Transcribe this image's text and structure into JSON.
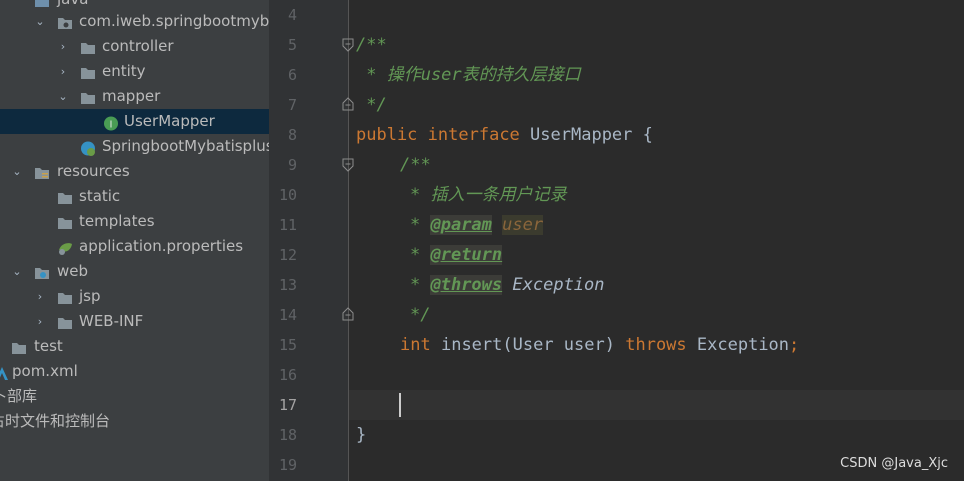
{
  "tree": {
    "items": [
      {
        "label": "java"
      },
      {
        "label": "com.iweb.springbootmyba"
      },
      {
        "label": "controller"
      },
      {
        "label": "entity"
      },
      {
        "label": "mapper"
      },
      {
        "label": "UserMapper"
      },
      {
        "label": "SpringbootMybatisplus"
      },
      {
        "label": "resources"
      },
      {
        "label": "static"
      },
      {
        "label": "templates"
      },
      {
        "label": "application.properties"
      },
      {
        "label": "web"
      },
      {
        "label": "jsp"
      },
      {
        "label": "WEB-INF"
      },
      {
        "label": "test"
      },
      {
        "label": "pom.xml"
      },
      {
        "label": "卜部库"
      },
      {
        "label": "占时文件和控制台"
      }
    ]
  },
  "editor": {
    "line_numbers": [
      "4",
      "5",
      "6",
      "7",
      "8",
      "9",
      "10",
      "11",
      "12",
      "13",
      "14",
      "15",
      "16",
      "17",
      "18",
      "19"
    ],
    "current_line": "17",
    "code": {
      "l5": "/**",
      "l6": " * 操作user表的持久层接口",
      "l7": " */",
      "l8_kw1": "public",
      "l8_kw2": "interface",
      "l8_name": "UserMapper",
      "l8_brace": "{",
      "l9": "/**",
      "l10": "* 插入一条用户记录",
      "l11_star": "* ",
      "l11_tag": "@param",
      "l11_name": "user",
      "l12_star": "* ",
      "l12_tag": "@return",
      "l13_star": "* ",
      "l13_tag": "@throws",
      "l13_ref": "Exception",
      "l14": "*/",
      "l15_kw1": "int",
      "l15_method": "insert",
      "l15_params": "(User user)",
      "l15_kw2": "throws",
      "l15_exc": "Exception",
      "l15_semi": ";",
      "l18": "}"
    }
  },
  "watermark": "CSDN @Java_Xjc"
}
